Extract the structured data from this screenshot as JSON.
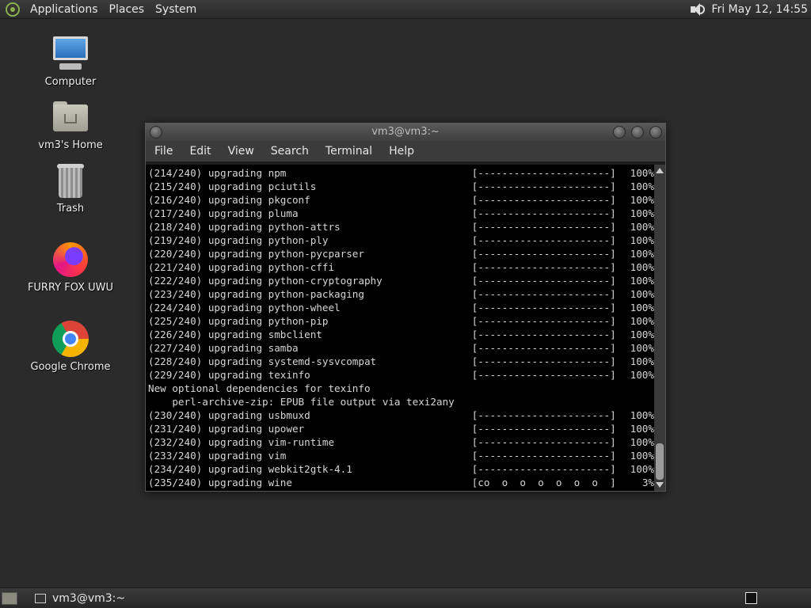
{
  "top_panel": {
    "menus": [
      "Applications",
      "Places",
      "System"
    ],
    "clock": "Fri May 12, 14:55"
  },
  "desktop": {
    "icons": [
      {
        "label": "Computer",
        "icon": "computer-icon"
      },
      {
        "label": "vm3's Home",
        "icon": "home-folder-icon"
      },
      {
        "label": "Trash",
        "icon": "trash-icon"
      },
      {
        "label": "FURRY FOX UWU",
        "icon": "firefox-icon"
      },
      {
        "label": "Google Chrome",
        "icon": "chrome-icon"
      }
    ]
  },
  "terminal": {
    "title": "vm3@vm3:~",
    "menu": [
      "File",
      "Edit",
      "View",
      "Search",
      "Terminal",
      "Help"
    ],
    "lines": [
      {
        "left": "(214/240) upgrading npm",
        "bar": "[----------------------]",
        "pct": "100%"
      },
      {
        "left": "(215/240) upgrading pciutils",
        "bar": "[----------------------]",
        "pct": "100%"
      },
      {
        "left": "(216/240) upgrading pkgconf",
        "bar": "[----------------------]",
        "pct": "100%"
      },
      {
        "left": "(217/240) upgrading pluma",
        "bar": "[----------------------]",
        "pct": "100%"
      },
      {
        "left": "(218/240) upgrading python-attrs",
        "bar": "[----------------------]",
        "pct": "100%"
      },
      {
        "left": "(219/240) upgrading python-ply",
        "bar": "[----------------------]",
        "pct": "100%"
      },
      {
        "left": "(220/240) upgrading python-pycparser",
        "bar": "[----------------------]",
        "pct": "100%"
      },
      {
        "left": "(221/240) upgrading python-cffi",
        "bar": "[----------------------]",
        "pct": "100%"
      },
      {
        "left": "(222/240) upgrading python-cryptography",
        "bar": "[----------------------]",
        "pct": "100%"
      },
      {
        "left": "(223/240) upgrading python-packaging",
        "bar": "[----------------------]",
        "pct": "100%"
      },
      {
        "left": "(224/240) upgrading python-wheel",
        "bar": "[----------------------]",
        "pct": "100%"
      },
      {
        "left": "(225/240) upgrading python-pip",
        "bar": "[----------------------]",
        "pct": "100%"
      },
      {
        "left": "(226/240) upgrading smbclient",
        "bar": "[----------------------]",
        "pct": "100%"
      },
      {
        "left": "(227/240) upgrading samba",
        "bar": "[----------------------]",
        "pct": "100%"
      },
      {
        "left": "(228/240) upgrading systemd-sysvcompat",
        "bar": "[----------------------]",
        "pct": "100%"
      },
      {
        "left": "(229/240) upgrading texinfo",
        "bar": "[----------------------]",
        "pct": "100%"
      },
      {
        "left": "New optional dependencies for texinfo",
        "bar": "",
        "pct": ""
      },
      {
        "left": "    perl-archive-zip: EPUB file output via texi2any",
        "bar": "",
        "pct": ""
      },
      {
        "left": "(230/240) upgrading usbmuxd",
        "bar": "[----------------------]",
        "pct": "100%"
      },
      {
        "left": "(231/240) upgrading upower",
        "bar": "[----------------------]",
        "pct": "100%"
      },
      {
        "left": "(232/240) upgrading vim-runtime",
        "bar": "[----------------------]",
        "pct": "100%"
      },
      {
        "left": "(233/240) upgrading vim",
        "bar": "[----------------------]",
        "pct": "100%"
      },
      {
        "left": "(234/240) upgrading webkit2gtk-4.1",
        "bar": "[----------------------]",
        "pct": "100%"
      },
      {
        "left": "(235/240) upgrading wine",
        "bar": "[co  o  o  o  o  o  o  ]",
        "pct": "3%"
      }
    ]
  },
  "bottom_panel": {
    "task": "vm3@vm3:~"
  }
}
